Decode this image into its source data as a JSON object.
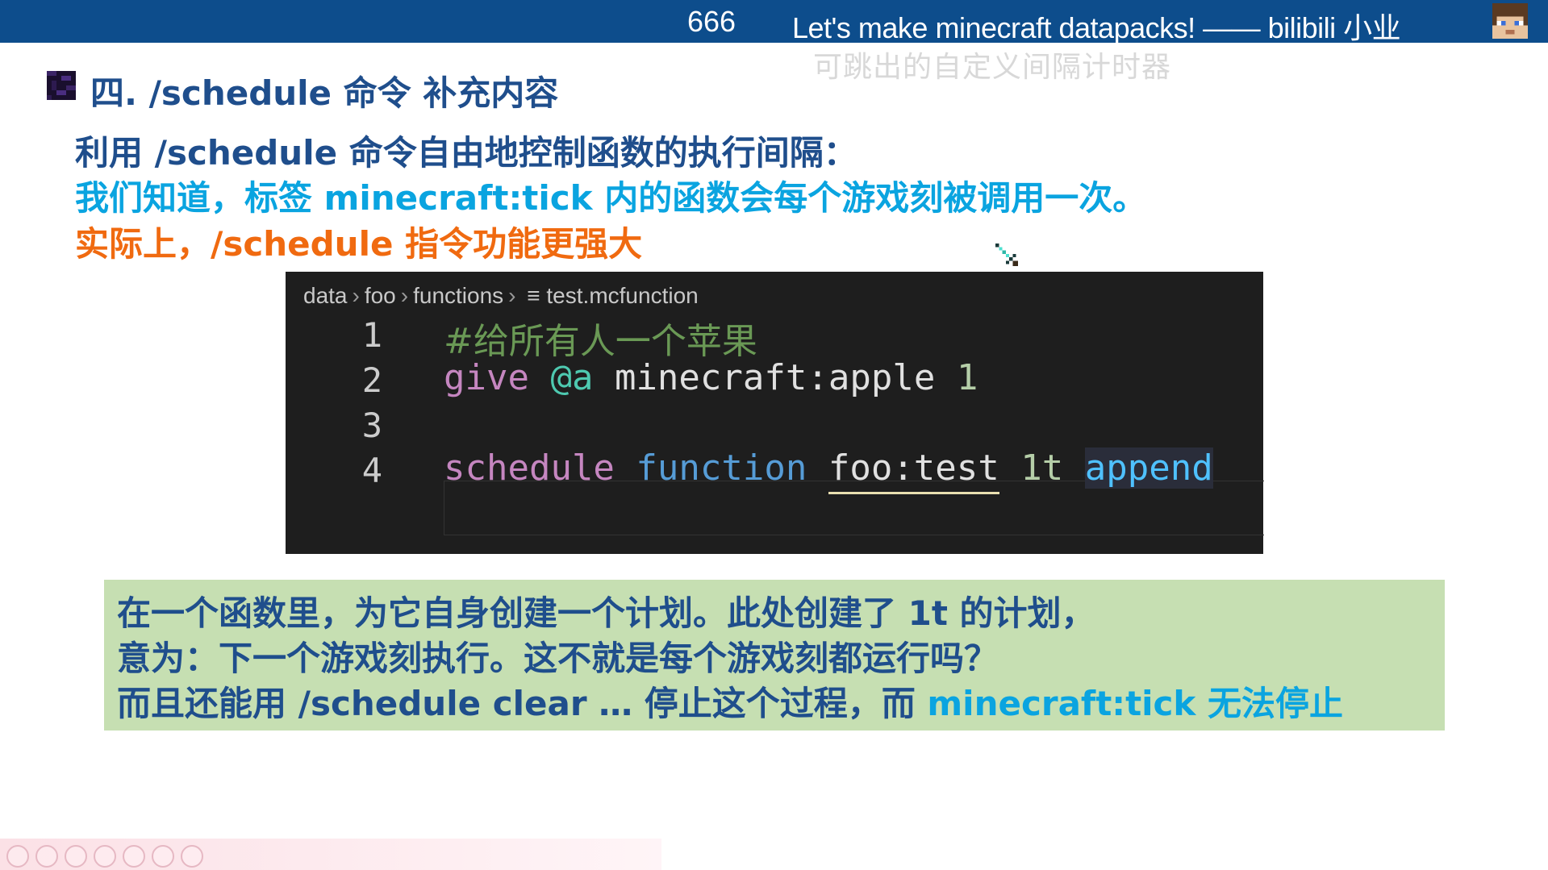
{
  "topbar": {
    "counter": "666",
    "title": "Let's make minecraft datapacks!  —— bilibili 小业",
    "overlay_subtitle": "可跳出的自定义间隔计时器"
  },
  "heading": {
    "title": "四. /schedule 命令 补充内容"
  },
  "intro": {
    "line1": "利用 /schedule 命令自由地控制函数的执行间隔：",
    "line2": "我们知道，标签 minecraft:tick 内的函数会每个游戏刻被调用一次。",
    "line3": "实际上，/schedule 指令功能更强大"
  },
  "editor": {
    "breadcrumb": [
      "data",
      "foo",
      "functions",
      "test.mcfunction"
    ],
    "file_icon": "file-lines-icon",
    "lines": [
      {
        "n": "1",
        "comment": "#给所有人一个苹果"
      },
      {
        "n": "2",
        "cmd": "give",
        "sel": "@a",
        "item": "minecraft:apple",
        "count": "1"
      },
      {
        "n": "3"
      },
      {
        "n": "4",
        "cmd": "schedule",
        "sub": "function",
        "target": "foo:test",
        "time": "1t",
        "mode": "append"
      }
    ]
  },
  "note": {
    "line1": "在一个函数里，为它自身创建一个计划。此处创建了 1t 的计划，",
    "line2": "意为：下一个游戏刻执行。这不就是每个游戏刻都运行吗？",
    "line3_prefix": "而且还能用 /schedule clear … 停止这个过程，而 ",
    "line3_highlight": "minecraft:tick 无法停止"
  },
  "colors": {
    "topbar": "#0d4d8c",
    "heading": "#1f4e8c",
    "cyan": "#0aa4e0",
    "orange": "#f06a10",
    "note_bg": "#c6dfb2",
    "editor_bg": "#1e1e1e"
  },
  "icons": [
    "obsidian-block-icon",
    "avatar-icon",
    "diamond-sword-cursor-icon",
    "file-lines-icon"
  ]
}
